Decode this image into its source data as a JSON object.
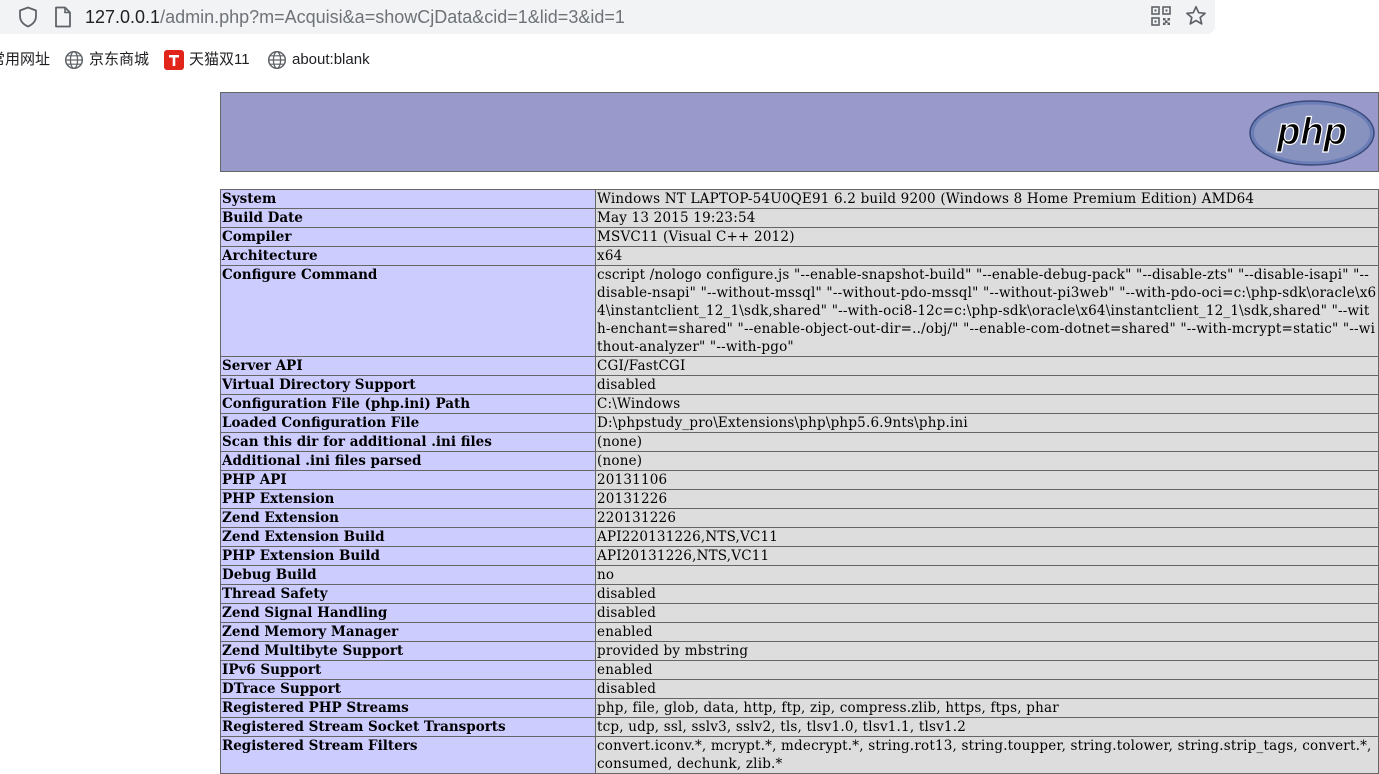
{
  "browser": {
    "url_host": "127.0.0.1",
    "url_path": "/admin.php?m=Acquisi&a=showCjData&cid=1&lid=3&id=1",
    "bookmarks": [
      {
        "label": "常用网址",
        "icon": "none"
      },
      {
        "label": "京东商城",
        "icon": "globe-icon"
      },
      {
        "label": "天猫双11",
        "icon": "tmall-icon"
      },
      {
        "label": "about:blank",
        "icon": "globe-icon"
      }
    ]
  },
  "header": {
    "logo_text": "php",
    "colors": {
      "header_bg": "#9999cc",
      "key_bg": "#ccccff",
      "value_bg": "#dddddd"
    }
  },
  "rows": [
    {
      "key": "System",
      "value": "Windows NT LAPTOP-54U0QE91 6.2 build 9200 (Windows 8 Home Premium Edition) AMD64"
    },
    {
      "key": "Build Date",
      "value": "May 13 2015 19:23:54"
    },
    {
      "key": "Compiler",
      "value": "MSVC11 (Visual C++ 2012)"
    },
    {
      "key": "Architecture",
      "value": "x64"
    },
    {
      "key": "Configure Command",
      "value": "cscript /nologo configure.js \"--enable-snapshot-build\" \"--enable-debug-pack\" \"--disable-zts\" \"--disable-isapi\" \"--disable-nsapi\" \"--without-mssql\" \"--without-pdo-mssql\" \"--without-pi3web\" \"--with-pdo-oci=c:\\php-sdk\\oracle\\x64\\instantclient_12_1\\sdk,shared\" \"--with-oci8-12c=c:\\php-sdk\\oracle\\x64\\instantclient_12_1\\sdk,shared\" \"--with-enchant=shared\" \"--enable-object-out-dir=../obj/\" \"--enable-com-dotnet=shared\" \"--with-mcrypt=static\" \"--without-analyzer\" \"--with-pgo\""
    },
    {
      "key": "Server API",
      "value": "CGI/FastCGI"
    },
    {
      "key": "Virtual Directory Support",
      "value": "disabled"
    },
    {
      "key": "Configuration File (php.ini) Path",
      "value": "C:\\Windows"
    },
    {
      "key": "Loaded Configuration File",
      "value": "D:\\phpstudy_pro\\Extensions\\php\\php5.6.9nts\\php.ini"
    },
    {
      "key": "Scan this dir for additional .ini files",
      "value": "(none)"
    },
    {
      "key": "Additional .ini files parsed",
      "value": "(none)"
    },
    {
      "key": "PHP API",
      "value": "20131106"
    },
    {
      "key": "PHP Extension",
      "value": "20131226"
    },
    {
      "key": "Zend Extension",
      "value": "220131226"
    },
    {
      "key": "Zend Extension Build",
      "value": "API220131226,NTS,VC11"
    },
    {
      "key": "PHP Extension Build",
      "value": "API20131226,NTS,VC11"
    },
    {
      "key": "Debug Build",
      "value": "no"
    },
    {
      "key": "Thread Safety",
      "value": "disabled"
    },
    {
      "key": "Zend Signal Handling",
      "value": "disabled"
    },
    {
      "key": "Zend Memory Manager",
      "value": "enabled"
    },
    {
      "key": "Zend Multibyte Support",
      "value": "provided by mbstring"
    },
    {
      "key": "IPv6 Support",
      "value": "enabled"
    },
    {
      "key": "DTrace Support",
      "value": "disabled"
    },
    {
      "key": "Registered PHP Streams",
      "value": "php, file, glob, data, http, ftp, zip, compress.zlib, https, ftps, phar"
    },
    {
      "key": "Registered Stream Socket Transports",
      "value": "tcp, udp, ssl, sslv3, sslv2, tls, tlsv1.0, tlsv1.1, tlsv1.2"
    },
    {
      "key": "Registered Stream Filters",
      "value": "convert.iconv.*, mcrypt.*, mdecrypt.*, string.rot13, string.toupper, string.tolower, string.strip_tags, convert.*, consumed, dechunk, zlib.*"
    }
  ]
}
